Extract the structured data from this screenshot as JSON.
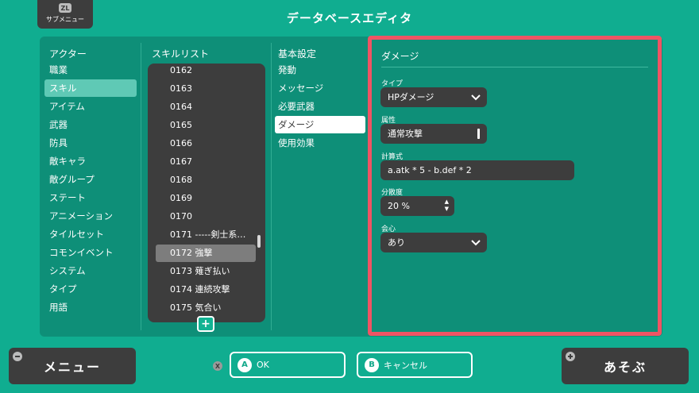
{
  "header": {
    "submenu_badge": "ZL",
    "submenu_label": "サブメニュー",
    "title": "データベースエディタ"
  },
  "categories": {
    "header": "アクター",
    "items": [
      "職業",
      "スキル",
      "アイテム",
      "武器",
      "防具",
      "敵キャラ",
      "敵グループ",
      "ステート",
      "アニメーション",
      "タイルセット",
      "コモンイベント",
      "システム",
      "タイプ",
      "用語"
    ],
    "selected": "スキル"
  },
  "skills": {
    "header": "スキルリスト",
    "items": [
      "0162",
      "0163",
      "0164",
      "0165",
      "0166",
      "0167",
      "0168",
      "0169",
      "0170",
      "0171 -----剣士系…",
      "0172 強撃",
      "0173 薙ぎ払い",
      "0174 連続攻撃",
      "0175 気合い"
    ],
    "selected": "0172 強撃",
    "add_label": "+"
  },
  "tabs": {
    "header": "基本設定",
    "items": [
      "発動",
      "メッセージ",
      "必要武器",
      "ダメージ",
      "使用効果"
    ],
    "selected": "ダメージ"
  },
  "damage": {
    "section_title": "ダメージ",
    "type_label": "タイプ",
    "type_value": "HPダメージ",
    "element_label": "属性",
    "element_value": "通常攻撃",
    "formula_label": "計算式",
    "formula_value": "a.atk * 5 - b.def * 2",
    "variance_label": "分散度",
    "variance_value": "20 %",
    "critical_label": "会心",
    "critical_value": "あり"
  },
  "footer": {
    "menu_label": "メニュー",
    "x_hint": "X",
    "ok_letter": "A",
    "ok_label": "OK",
    "cancel_letter": "B",
    "cancel_label": "キャンセル",
    "play_label": "あそぶ"
  },
  "colors": {
    "background": "#10ad90",
    "panel": "#0e8f78",
    "dark": "#3d3d3d",
    "highlight_border": "#ef5464",
    "selected_category": "#5fc9b5"
  }
}
